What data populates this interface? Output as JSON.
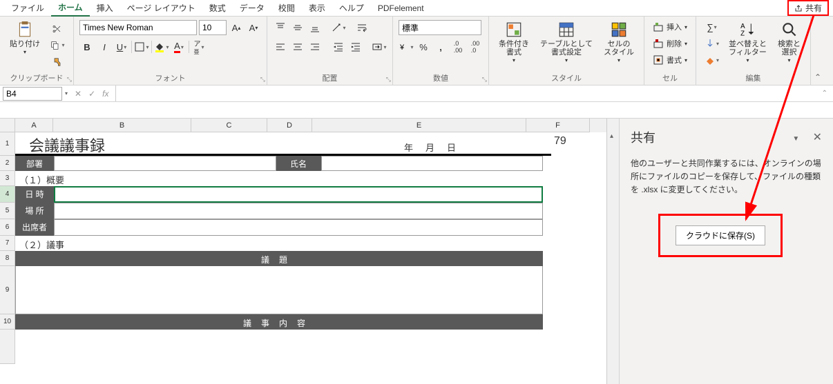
{
  "tabs": {
    "file": "ファイル",
    "home": "ホーム",
    "insert": "挿入",
    "page": "ページ レイアウト",
    "formula": "数式",
    "data": "データ",
    "review": "校閲",
    "view": "表示",
    "help": "ヘルプ",
    "pdf": "PDFelement"
  },
  "share_label": "共有",
  "ribbon": {
    "clipboard": {
      "paste": "貼り付け",
      "label": "クリップボード"
    },
    "font": {
      "name": "Times New Roman",
      "size": "10",
      "label": "フォント"
    },
    "align": {
      "label": "配置"
    },
    "number": {
      "format": "標準",
      "label": "数値"
    },
    "styles": {
      "cond": "条件付き\n書式",
      "table": "テーブルとして\n書式設定",
      "cell": "セルの\nスタイル",
      "label": "スタイル"
    },
    "cells": {
      "insert": "挿入",
      "delete": "削除",
      "format": "書式",
      "label": "セル"
    },
    "editing": {
      "sort": "並べ替えと\nフィルター",
      "find": "検索と\n選択",
      "label": "編集"
    }
  },
  "namebox": "B4",
  "cols": {
    "a": "A",
    "b": "B",
    "c": "C",
    "d": "D",
    "e": "E",
    "f": "F"
  },
  "doc": {
    "title": "会議議事録",
    "date": "年月日",
    "f_val": "79",
    "dept": "部署",
    "name": "氏名",
    "sec1": "（１）概要",
    "datetime": "日  時",
    "place": "場  所",
    "attendees": "出席者",
    "sec2": "（２）議事",
    "topic": "議題",
    "content": "議事内容"
  },
  "panel": {
    "title": "共有",
    "text": "他のユーザーと共同作業するには、オンラインの場所にファイルのコピーを保存して、ファイルの種類を .xlsx に変更してください。",
    "button": "クラウドに保存(S)"
  }
}
